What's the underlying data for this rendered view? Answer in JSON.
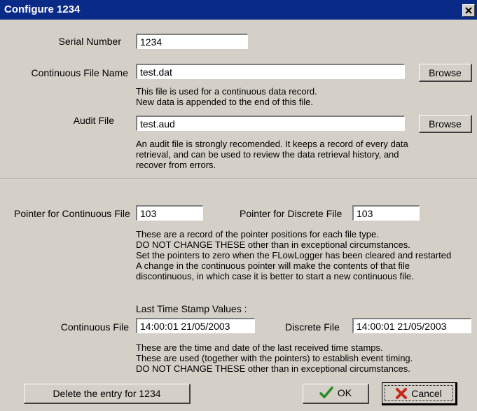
{
  "window": {
    "title": "Configure 1234"
  },
  "serial": {
    "label": "Serial Number",
    "value": "1234"
  },
  "continuous_file": {
    "label": "Continuous File Name",
    "value": "test.dat",
    "browse_label": "Browse",
    "note": [
      "This file is used for a continuous data record.",
      "New data is appended to the end of this file."
    ]
  },
  "audit_file": {
    "label": "Audit File",
    "value": "test.aud",
    "browse_label": "Browse",
    "note": [
      "An audit file is strongly recomended. It keeps a record of every data",
      "retrieval, and can be used to review the data retrieval history, and",
      "recover from errors."
    ]
  },
  "pointers": {
    "continuous_label": "Pointer for Continuous File",
    "continuous_value": "103",
    "discrete_label": "Pointer for Discrete File",
    "discrete_value": "103",
    "note": [
      "These are a record of the pointer positions for each file type.",
      "DO NOT CHANGE THESE other than in exceptional circumstances.",
      "Set the pointers to zero when the FLowLogger has been cleared and restarted",
      "A change in the continuous pointer will make  the contents of that file",
      "discontinuous, in which case it is better to start a new continuous file."
    ]
  },
  "timestamps": {
    "heading": "Last Time Stamp Values :",
    "continuous_label": "Continuous File",
    "continuous_value": "14:00:01 21/05/2003",
    "discrete_label": "Discrete File",
    "discrete_value": "14:00:01 21/05/2003",
    "note": [
      "These are the time and date of the last received time stamps.",
      "These are used (together with the pointers) to establish event timing.",
      "DO NOT CHANGE THESE other than in exceptional circumstances."
    ]
  },
  "buttons": {
    "delete_label": "Delete the entry for 1234",
    "ok_label": "OK",
    "cancel_label": "Cancel"
  },
  "icons": {
    "ok": "checkmark-icon",
    "cancel": "x-mark-icon",
    "close": "close-icon"
  },
  "colors": {
    "titlebar": "#0a2a88",
    "dialog_bg": "#d4d0c8",
    "ok_check": "#2a8a2a",
    "cancel_x": "#c8281c"
  }
}
